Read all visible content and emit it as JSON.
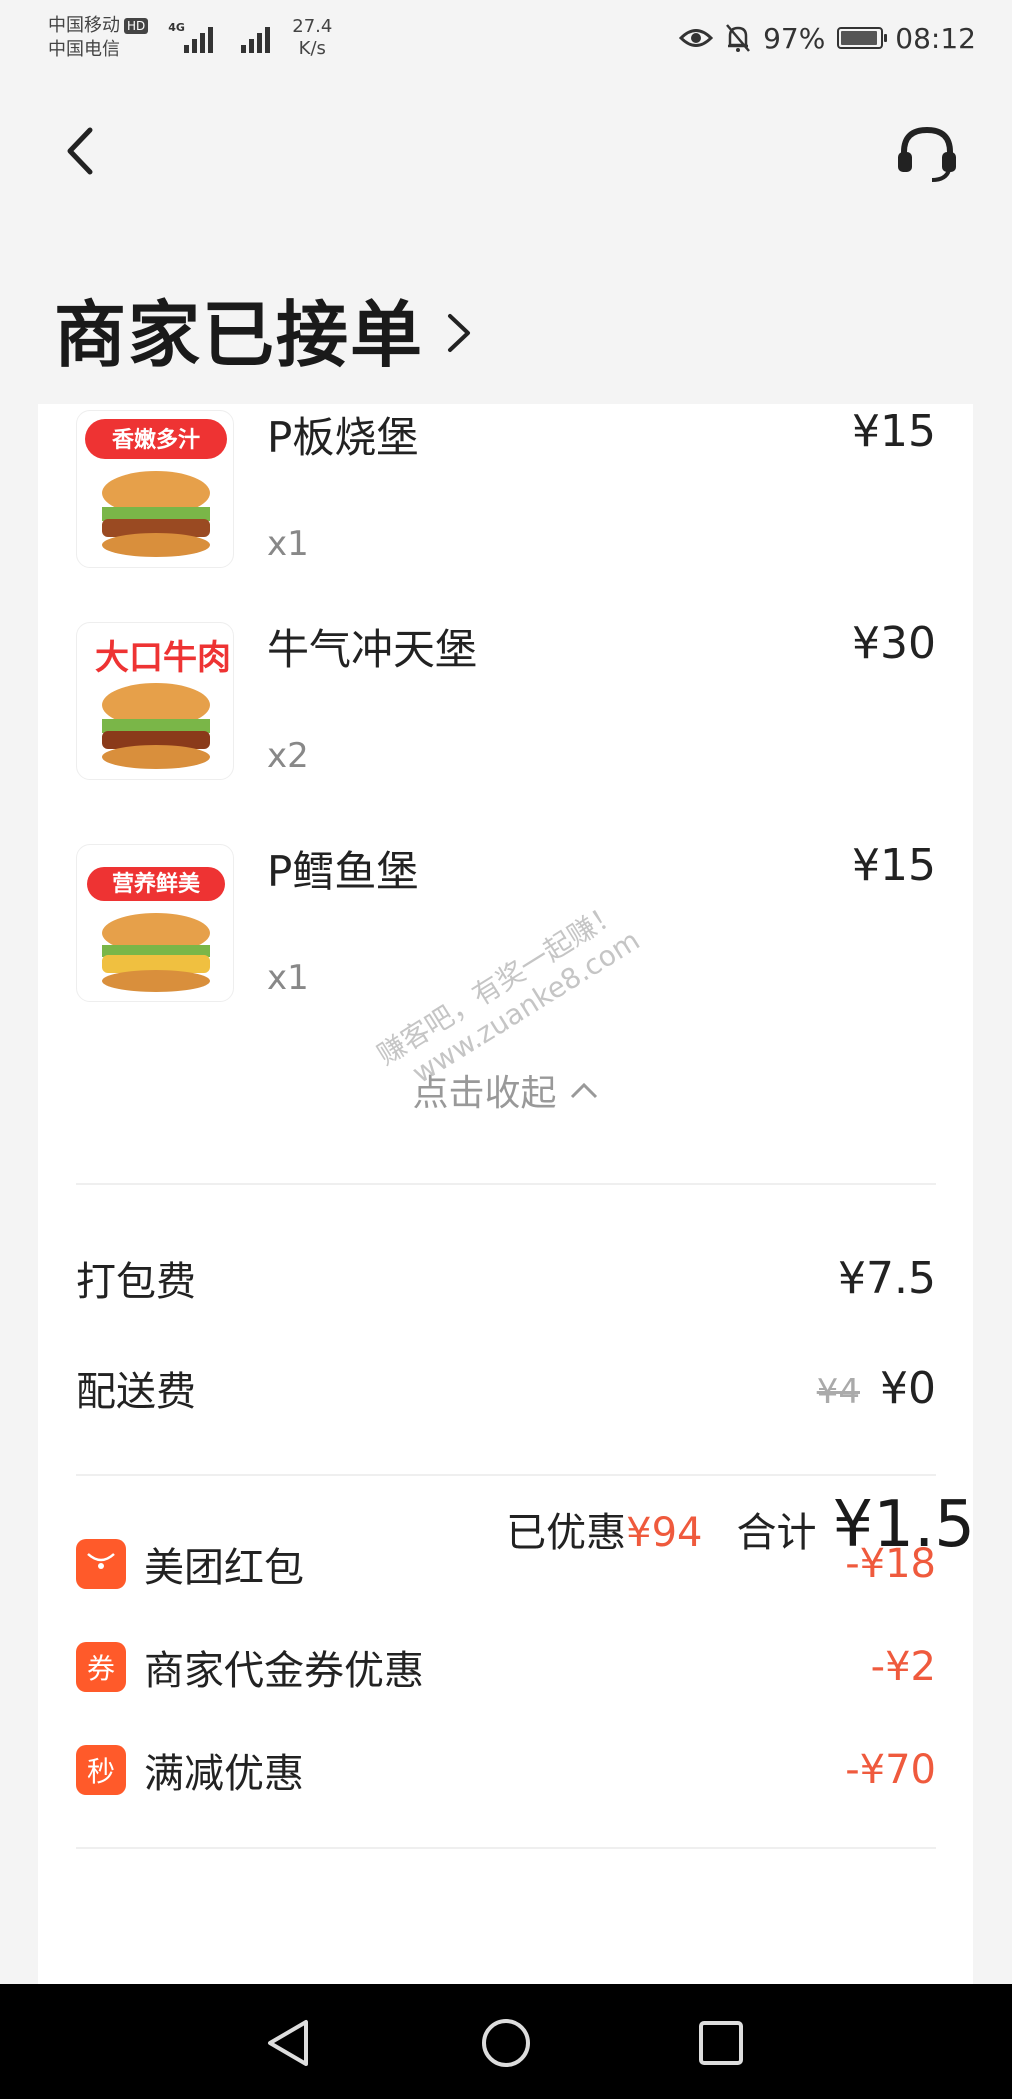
{
  "status_bar": {
    "carrier_1": "中国移动",
    "carrier_1_badge": "HD",
    "carrier_2": "中国电信",
    "network_type": "4G",
    "speed_value": "27.4",
    "speed_unit": "K/s",
    "battery": "97%",
    "time": "08:12"
  },
  "header": {
    "title": "商家已接单"
  },
  "items": [
    {
      "name": "P板烧堡",
      "qty": "x1",
      "price": "¥15",
      "badge": "香嫩多汁"
    },
    {
      "name": "牛气冲天堡",
      "qty": "x2",
      "price": "¥30",
      "badge": "大口牛肉"
    },
    {
      "name": "P鳕鱼堡",
      "qty": "x1",
      "price": "¥15",
      "badge": "营养鲜美"
    }
  ],
  "collapse_label": "点击收起",
  "watermark": {
    "line1": "赚客吧，有奖一起赚！",
    "line2": "www.zuanke8.com"
  },
  "fees": {
    "packing_label": "打包费",
    "packing_value": "¥7.5",
    "delivery_label": "配送费",
    "delivery_original": "¥4",
    "delivery_value": "¥0"
  },
  "promotions": [
    {
      "icon_text": "",
      "label": "美团红包",
      "value": "-¥18"
    },
    {
      "icon_text": "券",
      "label": "商家代金券优惠",
      "value": "-¥2"
    },
    {
      "icon_text": "秒",
      "label": "满减优惠",
      "value": "-¥70"
    }
  ],
  "summary": {
    "saved_label": "已优惠",
    "saved_value": "¥94",
    "total_label": "合计",
    "total_value": "¥1.5"
  },
  "colors": {
    "accent": "#ef5a3d",
    "promo_icon": "#ff5a2a",
    "background": "#f4f4f4"
  }
}
